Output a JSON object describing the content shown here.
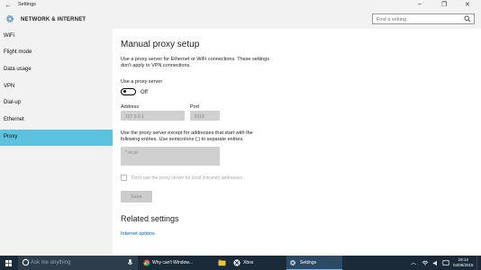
{
  "window": {
    "title": "Settings",
    "back_icon": "back-arrow-icon",
    "controls": [
      "–",
      "❐",
      "✕"
    ]
  },
  "header": {
    "title": "NETWORK & INTERNET",
    "search_placeholder": "Find a setting"
  },
  "sidebar": {
    "items": [
      {
        "label": "WiFi"
      },
      {
        "label": "Flight mode"
      },
      {
        "label": "Data usage"
      },
      {
        "label": "VPN"
      },
      {
        "label": "Dial-up"
      },
      {
        "label": "Ethernet"
      },
      {
        "label": "Proxy",
        "selected": true
      }
    ]
  },
  "main": {
    "title": "Manual proxy setup",
    "description_line1": "Use a proxy server for Ethernet or WiFi connections. These settings",
    "description_line2": "don't apply to VPN connections.",
    "use_proxy_label": "Use a proxy server",
    "toggle_state": "Off",
    "address_label": "Address",
    "address_value": "127.0.0.1",
    "port_label": "Port",
    "port_value": "8118",
    "exceptions_line1": "Use the proxy server except for addresses that start with the",
    "exceptions_line2": "following entries. Use semicolons (;) to separate entries.",
    "exceptions_value": "*.local",
    "local_checkbox_label": "Don't use the proxy server for local (intranet) addresses",
    "save_label": "Save",
    "related_title": "Related settings",
    "related_link": "Internet options"
  },
  "taskbar": {
    "search_text": "Ask me anything",
    "tasks": [
      {
        "label": "Why can't Window...",
        "icon": "chrome-icon"
      },
      {
        "label": "Xbox",
        "icon": "xbox-icon"
      },
      {
        "label": "Settings",
        "icon": "settings-icon",
        "active": true
      }
    ],
    "time": "19:14",
    "date": "04/08/2015"
  },
  "colors": {
    "accent": "#5dc2e0",
    "link": "#0063b1",
    "taskbar": "#1b2a38"
  }
}
